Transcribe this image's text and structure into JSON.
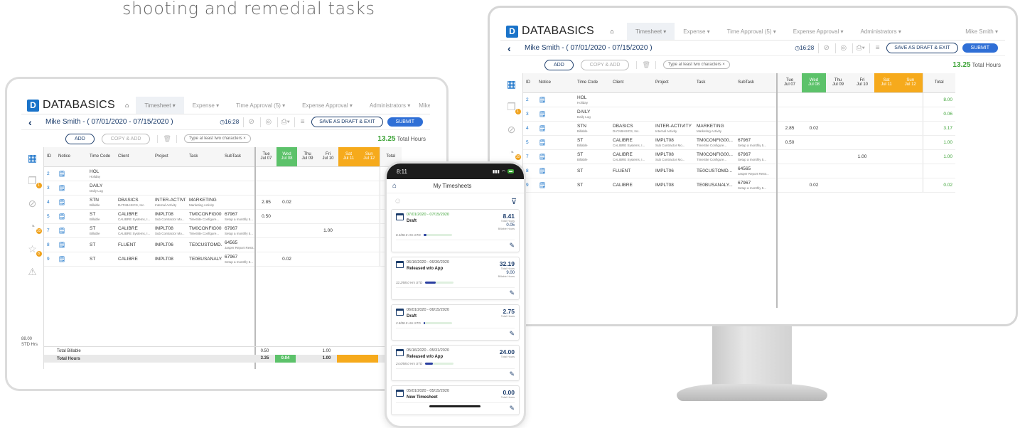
{
  "tagline": "shooting and remedial tasks",
  "app": {
    "logo_text": "DATABASICS",
    "nav": [
      "Timesheet ▾",
      "Expense ▾",
      "Time Approval (5) ▾",
      "Expense Approval ▾",
      "Administrators ▾"
    ],
    "user": "Mike Smith ▾",
    "sheet_title": "Mike Smith - ( 07/01/2020 - 07/15/2020 )",
    "clock": "16:28",
    "save_draft_label": "SAVE AS DRAFT & EXIT",
    "submit_label": "SUBMIT",
    "add_label": "ADD",
    "copy_add_label": "COPY & ADD",
    "filter_placeholder": "Type at least two characters",
    "total_hours_value": "13.25",
    "total_hours_label": "Total Hours",
    "columns": [
      "ID",
      "Notice",
      "Time Code",
      "Client",
      "Project",
      "Task",
      "SubTask"
    ],
    "days": [
      {
        "dow": "Tue",
        "date": "Jul 07",
        "tone": ""
      },
      {
        "dow": "Wed",
        "date": "Jul 08",
        "tone": "wed"
      },
      {
        "dow": "Thu",
        "date": "Jul 09",
        "tone": ""
      },
      {
        "dow": "Fri",
        "date": "Jul 10",
        "tone": ""
      },
      {
        "dow": "Sat",
        "date": "Jul 11",
        "tone": "sat"
      },
      {
        "dow": "Sun",
        "date": "Jul 12",
        "tone": "sat"
      }
    ],
    "total_col_label": "Total",
    "rows": [
      {
        "id": "2",
        "code": "HOL",
        "code_sub": "Holiday",
        "client": "",
        "client_sub": "",
        "project": "",
        "project_sub": "",
        "task": "",
        "task_sub": "",
        "subtask": "",
        "subtask_sub": "",
        "hours": [
          "",
          "",
          "",
          "",
          "",
          ""
        ],
        "total": "8.00"
      },
      {
        "id": "3",
        "code": "DAILY",
        "code_sub": "Daily Log",
        "client": "",
        "client_sub": "",
        "project": "",
        "project_sub": "",
        "task": "",
        "task_sub": "",
        "subtask": "",
        "subtask_sub": "",
        "hours": [
          "",
          "",
          "",
          "",
          "",
          ""
        ],
        "total": "0.06"
      },
      {
        "id": "4",
        "code": "STN",
        "code_sub": "Billable",
        "client": "DBASICS",
        "client_sub": "DATABASICS, Inc.",
        "project": "INTER-ACTIVITY",
        "project_sub": "Internal Activity",
        "task": "MARKETING",
        "task_sub": "Marketing Activity",
        "subtask": "",
        "subtask_sub": "",
        "hours": [
          "2.85",
          "0.02",
          "",
          "",
          "",
          ""
        ],
        "total": "3.17"
      },
      {
        "id": "5",
        "code": "ST",
        "code_sub": "Billable",
        "client": "CALIBRE",
        "client_sub": "CALIBRE Systems, I...",
        "project": "IMPLT08",
        "project_sub": "Sub Contractor Mo...",
        "task": "TM0CONFIG00...",
        "task_sub": "TimeSite Configure...",
        "subtask": "67967",
        "subtask_sub": "Setup a monthly 5...",
        "hours": [
          "0.50",
          "",
          "",
          "",
          "",
          ""
        ],
        "total": "1.00"
      },
      {
        "id": "7",
        "code": "ST",
        "code_sub": "Billable",
        "client": "CALIBRE",
        "client_sub": "CALIBRE Systems, I...",
        "project": "IMPLT08",
        "project_sub": "Sub Contractor Mo...",
        "task": "TM0CONFIG00...",
        "task_sub": "TimeSite Configure...",
        "subtask": "67967",
        "subtask_sub": "Setup a monthly 5...",
        "hours": [
          "",
          "",
          "",
          "1.00",
          "",
          ""
        ],
        "total": "1.00"
      },
      {
        "id": "8",
        "code": "ST",
        "code_sub": "",
        "client": "FLUENT",
        "client_sub": "",
        "project": "IMPLT06",
        "project_sub": "",
        "task": "TE0CUSTOMD...",
        "task_sub": "",
        "subtask": "64565",
        "subtask_sub": "Jasper Report Restr...",
        "hours": [
          "",
          "",
          "",
          "",
          "",
          ""
        ],
        "total": ""
      },
      {
        "id": "9",
        "code": "ST",
        "code_sub": "",
        "client": "CALIBRE",
        "client_sub": "",
        "project": "IMPLT08",
        "project_sub": "",
        "task": "TE0BUSANALY...",
        "task_sub": "",
        "subtask": "67967",
        "subtask_sub": "Setup a monthly 5...",
        "hours": [
          "",
          "0.02",
          "",
          "",
          "",
          ""
        ],
        "total": "0.02"
      }
    ],
    "footer": {
      "std_value": "88.00",
      "std_label": "STD Hrs",
      "billable_label": "Total Billable",
      "billable_hours": [
        "0.50",
        "",
        "",
        "1.00",
        "",
        ""
      ],
      "total_label": "Total Hours",
      "total_hours": [
        "3.35",
        "0.04",
        "",
        "1.00",
        "",
        ""
      ]
    },
    "side_icons": [
      {
        "name": "timesheet-icon",
        "glyph": "▦",
        "badge": "",
        "active": true
      },
      {
        "name": "documents-icon",
        "glyph": "❐",
        "badge": "1",
        "active": false
      },
      {
        "name": "attachment-icon",
        "glyph": "⊘",
        "badge": "",
        "active": false
      },
      {
        "name": "clock-icon",
        "glyph": "◔",
        "badge": "10",
        "active": false
      },
      {
        "name": "star-icon",
        "glyph": "☆",
        "badge": "8",
        "active": false
      },
      {
        "name": "warning-icon",
        "glyph": "⚠",
        "badge": "",
        "active": false
      }
    ]
  },
  "phone": {
    "time": "8:11",
    "title": "My Timesheets",
    "cards": [
      {
        "date": "07/01/2020 - 07/15/2020",
        "current": true,
        "status": "Draft",
        "hours": "8.41",
        "hours_label": "Total Hours",
        "billable": "0.05",
        "billable_label": "Billable Hours",
        "std": "8.4/88.0 Hrs STD",
        "fill": 0.1
      },
      {
        "date": "06/16/2020 - 06/30/2020",
        "current": false,
        "status": "Released w/o App",
        "hours": "32.19",
        "hours_label": "Total Hours",
        "billable": "9.00",
        "billable_label": "Billable Hours",
        "std": "32.2/88.0 Hrs STD",
        "fill": 0.37
      },
      {
        "date": "06/01/2020 - 06/15/2020",
        "current": false,
        "status": "Draft",
        "hours": "2.75",
        "hours_label": "Total Hours",
        "billable": "",
        "billable_label": "",
        "std": "2.8/88.0 Hrs STD",
        "fill": 0.03
      },
      {
        "date": "05/16/2020 - 05/31/2020",
        "current": false,
        "status": "Released w/o App",
        "hours": "24.00",
        "hours_label": "Total Hours",
        "billable": "",
        "billable_label": "",
        "std": "24.0/88.0 Hrs STD",
        "fill": 0.27
      },
      {
        "date": "05/01/2020 - 05/15/2020",
        "current": false,
        "status": "New Timesheet",
        "hours": "0.00",
        "hours_label": "Total Hours",
        "billable": "",
        "billable_label": "",
        "std": "",
        "fill": 0
      }
    ]
  }
}
